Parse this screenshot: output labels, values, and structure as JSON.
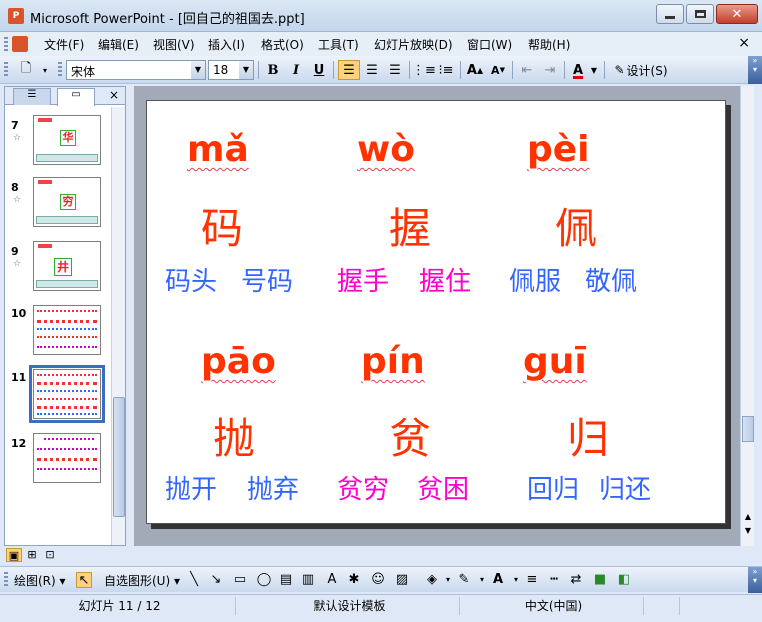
{
  "window": {
    "title": "Microsoft PowerPoint - [回自己的祖国去.ppt]"
  },
  "menu": {
    "items": [
      "文件(F)",
      "编辑(E)",
      "视图(V)",
      "插入(I)",
      "格式(O)",
      "工具(T)",
      "幻灯片放映(D)",
      "窗口(W)",
      "帮助(H)"
    ],
    "close": "×"
  },
  "toolbar": {
    "font": "宋体",
    "size": "18",
    "bold": "B",
    "italic": "I",
    "underline": "U",
    "design": "设计(S)"
  },
  "outline": {
    "close": "×",
    "thumbnails": [
      {
        "number": "7"
      },
      {
        "number": "8"
      },
      {
        "number": "9"
      },
      {
        "number": "10"
      },
      {
        "number": "11"
      },
      {
        "number": "12"
      }
    ]
  },
  "slide": {
    "row1": {
      "pinyin": [
        "mǎ",
        "wò",
        "pèi"
      ],
      "hanzi": [
        "码",
        "握",
        "佩"
      ],
      "words": [
        "码头",
        "号码",
        "握手",
        "握住",
        "佩服",
        "敬佩"
      ]
    },
    "row2": {
      "pinyin": [
        "pāo",
        "pín",
        "guī"
      ],
      "hanzi": [
        "抛",
        "贫",
        "归"
      ],
      "words": [
        "抛开",
        "抛弃",
        "贫穷",
        "贫困",
        "回归",
        "归还"
      ]
    }
  },
  "drawing": {
    "draw": "绘图(R)",
    "autoshapes": "自选图形(U)"
  },
  "status": {
    "slide": "幻灯片 11 / 12",
    "template": "默认设计模板",
    "language": "中文(中国)"
  },
  "colors": {
    "pinyin": "#ff3300",
    "word_blue": "#3366ff",
    "word_magenta": "#ff00cc"
  }
}
